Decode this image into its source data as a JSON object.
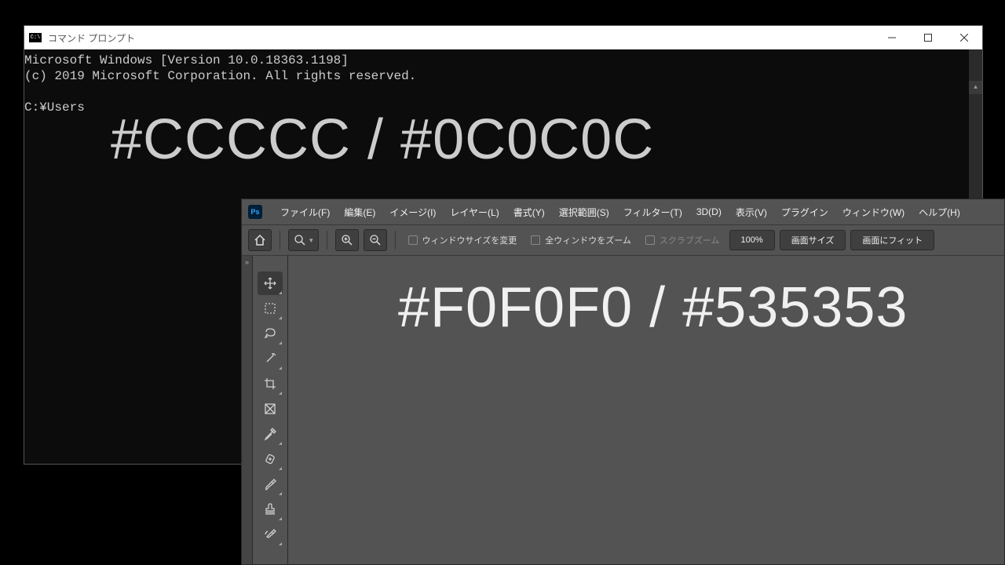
{
  "cmd": {
    "title": "コマンド プロンプト",
    "line1": "Microsoft Windows [Version 10.0.18363.1198]",
    "line2": "(c) 2019 Microsoft Corporation. All rights reserved.",
    "prompt": "C:¥Users",
    "overlay": "#CCCCC / #0C0C0C"
  },
  "ps": {
    "menu": [
      "ファイル(F)",
      "編集(E)",
      "イメージ(I)",
      "レイヤー(L)",
      "書式(Y)",
      "選択範囲(S)",
      "フィルター(T)",
      "3D(D)",
      "表示(V)",
      "プラグイン",
      "ウィンドウ(W)",
      "ヘルプ(H)"
    ],
    "opt_resize": "ウィンドウサイズを変更",
    "opt_zoomall": "全ウィンドウをズーム",
    "opt_scrub": "スクラブズーム",
    "zoom_value": "100%",
    "btn_screen": "画面サイズ",
    "btn_fit": "画面にフィット",
    "overlay": "#F0F0F0 / #535353"
  }
}
